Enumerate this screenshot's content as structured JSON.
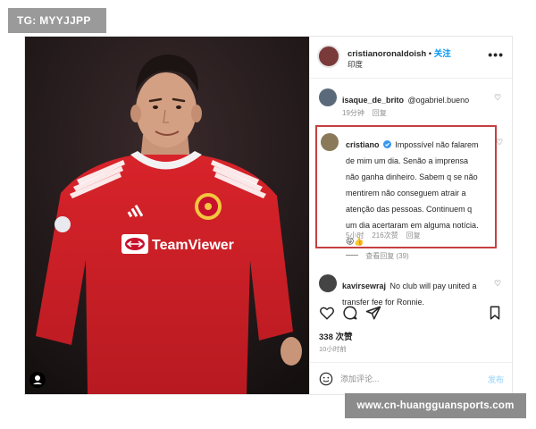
{
  "watermark_top": "TG: MYYJJPP",
  "watermark_bottom": "www.cn-huangguansports.com",
  "post": {
    "photo": {
      "sponsor_text": "TeamViewer"
    },
    "header": {
      "username": "cristianoronaldoish",
      "separator": "•",
      "follow_label": "关注",
      "subtitle": "印度",
      "more_label": "•••"
    },
    "comments": [
      {
        "username": "isaque_de_brito",
        "text": "@ogabriel.bueno",
        "time": "19分钟",
        "reply": "回复"
      },
      {
        "username": "cristiano",
        "verified": true,
        "text": "Impossível não falarem de mim um dia. Senão a imprensa não ganha dinheiro. Sabem q se não mentirem não conseguem atrair a atenção das pessoas. Continuem q um dia acertaram em alguma notícia.😜👍",
        "time": "5小时",
        "likes": "216次赞",
        "reply": "回复",
        "view_replies": "查看回复 (39)"
      },
      {
        "username": "kavirsewraj",
        "text": "No club will pay united a transfer fee for Ronnie."
      }
    ],
    "actions": {
      "like_icon": "heart-icon",
      "comment_icon": "comment-icon",
      "share_icon": "paper-plane-icon",
      "save_icon": "bookmark-icon"
    },
    "likes_count": "338 次赞",
    "time_ago": "10小时前",
    "add_comment": {
      "placeholder": "添加评论...",
      "post_label": "发布"
    }
  }
}
